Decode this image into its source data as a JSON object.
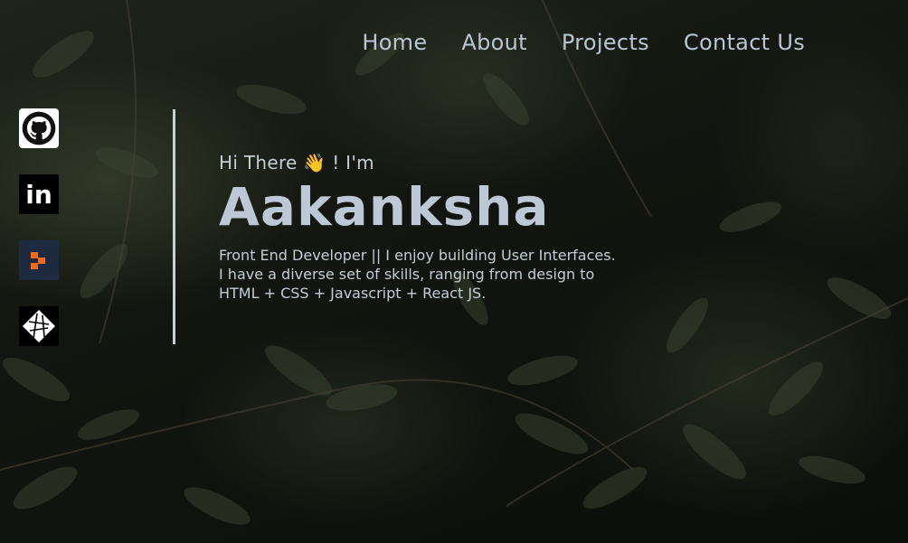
{
  "nav": {
    "items": [
      {
        "label": "Home"
      },
      {
        "label": "About"
      },
      {
        "label": "Projects"
      },
      {
        "label": "Contact Us"
      }
    ]
  },
  "social": {
    "icons": [
      "github-icon",
      "linkedin-icon",
      "dev-icon",
      "netlify-icon"
    ],
    "linkedin_text": "in"
  },
  "hero": {
    "greeting_start": "Hi There",
    "wave_emoji": "👋",
    "greeting_end": " ! I'm",
    "name": "Aakanksha",
    "bio_line1": "Front End Developer || I enjoy building User Interfaces.",
    "bio_line2": "I have a diverse set of skills, ranging from design to",
    "bio_line3": "HTML + CSS + Javascript + React JS."
  },
  "colors": {
    "text": "#c3cdd8",
    "divider": "#c6d0da",
    "background": "#12150f"
  }
}
